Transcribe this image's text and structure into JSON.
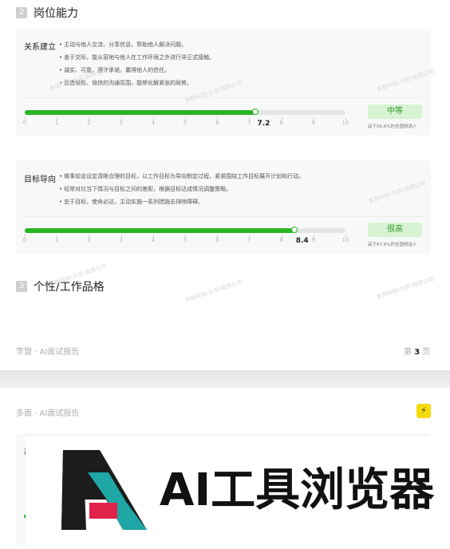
{
  "page1": {
    "section2": {
      "num": "2",
      "title": "岗位能力"
    },
    "cards": [
      {
        "label": "关系建立",
        "bullets": [
          "主动与他人交流、分享信息，帮助他人解决问题。",
          "善于交际，能从容地与他人在工作环境之外进行非正式接触。",
          "诚实、可靠，遵守承诺，赢得他人的信任。",
          "营造轻松、愉快的沟通氛围，能够化解紧张的局势。"
        ],
        "score": 7.2,
        "score_text": "7.2",
        "grade": "中等",
        "rank": "高于56.6%的全国候选人"
      },
      {
        "label": "目标导向",
        "bullets": [
          "做事前会设定清晰合理的目标，以工作目标为导向制定过程，紧紧围绕工作目标展开计划和行动。",
          "经常对比当下情况与目标之间的差距，根据目标达成情况调整策略。",
          "忠于目标，使命必达，主动实施一系列措施去排除障碍。"
        ],
        "score": 8.4,
        "score_text": "8.4",
        "grade": "很高",
        "rank": "高于87.8%的全国候选人"
      }
    ],
    "ticks": [
      "0",
      "1",
      "2",
      "3",
      "4",
      "5",
      "6",
      "7",
      "8",
      "9",
      "10"
    ],
    "section3": {
      "num": "3",
      "title": "个性/工作品格"
    },
    "footer": {
      "left": "李盟 · AI面试报告",
      "page_prefix": "第",
      "page_num": "3",
      "page_suffix": "页"
    }
  },
  "page2": {
    "header": "多面 · AI面试报告",
    "badge": "⚡",
    "partial_label": "肃"
  },
  "logo": {
    "text": "AI工具浏览器",
    "colors": {
      "dark": "#1c1c1c",
      "teal": "#1fa7a6",
      "red": "#e0224a",
      "black": "#111111"
    }
  },
  "watermark": "多面科技(北京)有限公司"
}
